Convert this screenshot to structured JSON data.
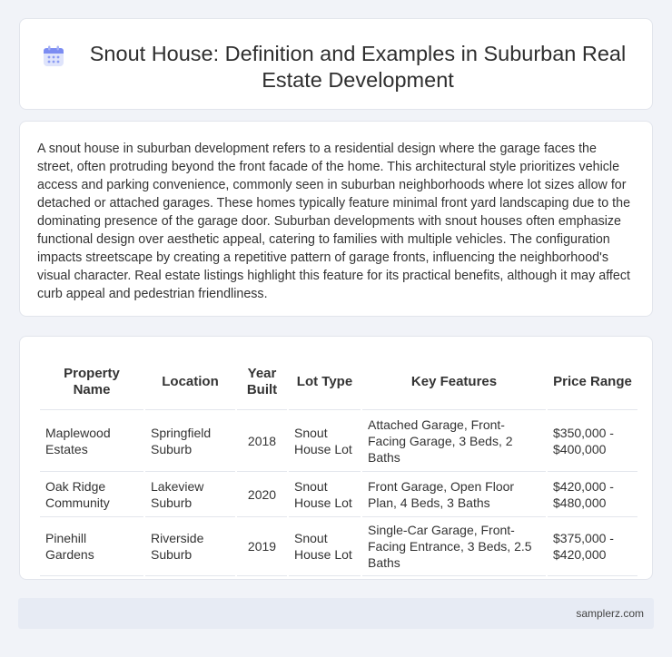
{
  "header": {
    "title": "Snout House: Definition and Examples in Suburban Real Estate Development",
    "icon": "calendar-icon",
    "icon_color": "#6b7ff0"
  },
  "description": "A snout house in suburban development refers to a residential design where the garage faces the street, often protruding beyond the front facade of the home. This architectural style prioritizes vehicle access and parking convenience, commonly seen in suburban neighborhoods where lot sizes allow for detached or attached garages. These homes typically feature minimal front yard landscaping due to the dominating presence of the garage door. Suburban developments with snout houses often emphasize functional design over aesthetic appeal, catering to families with multiple vehicles. The configuration impacts streetscape by creating a repetitive pattern of garage fronts, influencing the neighborhood's visual character. Real estate listings highlight this feature for its practical benefits, although it may affect curb appeal and pedestrian friendliness.",
  "table": {
    "headers": [
      "Property Name",
      "Location",
      "Year Built",
      "Lot Type",
      "Key Features",
      "Price Range"
    ],
    "rows": [
      [
        "Maplewood Estates",
        "Springfield Suburb",
        "2018",
        "Snout House Lot",
        "Attached Garage, Front-Facing Garage, 3 Beds, 2 Baths",
        "$350,000 - $400,000"
      ],
      [
        "Oak Ridge Community",
        "Lakeview Suburb",
        "2020",
        "Snout House Lot",
        "Front Garage, Open Floor Plan, 4 Beds, 3 Baths",
        "$420,000 - $480,000"
      ],
      [
        "Pinehill Gardens",
        "Riverside Suburb",
        "2019",
        "Snout House Lot",
        "Single-Car Garage, Front-Facing Entrance, 3 Beds, 2.5 Baths",
        "$375,000 - $420,000"
      ]
    ]
  },
  "footer": {
    "site": "samplerz.com"
  }
}
